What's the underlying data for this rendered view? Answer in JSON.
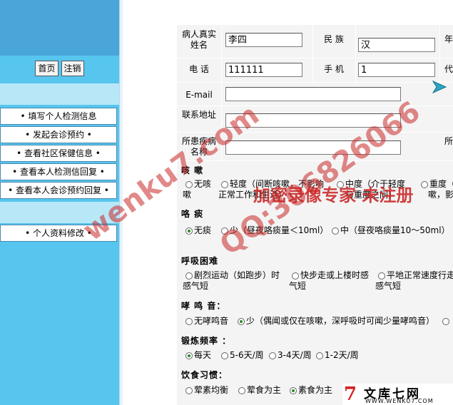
{
  "sidebar": {
    "buttons": {
      "home": "首页",
      "logout": "注销"
    },
    "menu1": [
      "• 填写个人检测信息",
      "• 发起会诊预约 •",
      "• 查看社区保健信息 •",
      "• 查看本人检测信回复 •",
      "• 查看本人会诊预约回复 •"
    ],
    "menu2": [
      "• 个人资料修改 •"
    ]
  },
  "form": {
    "name_label": "病人真实姓名",
    "name_value": "李四",
    "ethnic_label": "民 族",
    "ethnic_value": "汉",
    "phone_label": "电 话",
    "phone_value": "111111",
    "mobile_label": "手 机",
    "mobile_value": "1",
    "email_label": "E-mail",
    "email_value": "",
    "address_label": "联系地址",
    "address_value": "",
    "disease_label": "所患疾病名称",
    "disease_value": "",
    "edge_label_1": "年",
    "edge_label_2": "代",
    "edge_label_3": "所"
  },
  "sections": {
    "cough": {
      "title": "咳 嗽",
      "options": [
        "无咳",
        "轻度（间断咳嗽，不影响",
        "中度（介于轻度",
        "重度（"
      ],
      "wrap": [
        "嗽",
        "正常工作和生活）",
        "与重度之间）",
        "嗽，影响"
      ]
    },
    "sputum": {
      "title": "咯 痰",
      "options": [
        "无痰",
        "少（昼夜咯痰量＜10ml）",
        "中（昼夜咯痰量10～50ml）"
      ]
    },
    "dyspnea": {
      "title": "呼吸困难",
      "options": [
        "剧烈运动（如跑步）时",
        "快步走或上楼时感",
        "平地正常速度行走"
      ],
      "wrap": [
        "感气短",
        "气短",
        "感气短"
      ]
    },
    "wheeze": {
      "title": "哮 鸣 音：",
      "options": [
        "无哮鸣音",
        "少（偶闻或仅在咳嗽，深呼吸时可闻少量哮鸣音）"
      ]
    },
    "exercise": {
      "title": "锻炼频率 ：",
      "options": [
        "每天",
        "5-6天/周",
        "3-4天/周",
        "1-2天/周"
      ]
    },
    "diet": {
      "title": "饮食习惯：",
      "options": [
        "荤素均衡",
        "荤食为主",
        "素食为主"
      ]
    }
  },
  "watermarks": {
    "site": "wenku7.com",
    "qq": "QQ:306826066",
    "unregistered": "加密录像专家 未注册"
  },
  "logo": {
    "mark": "7",
    "text": "文库七网",
    "url": "WWW.WENKU7.COM"
  },
  "colors": {
    "sidebar": "#56c6ee",
    "sidebar_top": "#4aa6d8",
    "band": "#b8e8f8",
    "form_bg": "#f4f4f4",
    "checked": "#2a8a2a"
  }
}
